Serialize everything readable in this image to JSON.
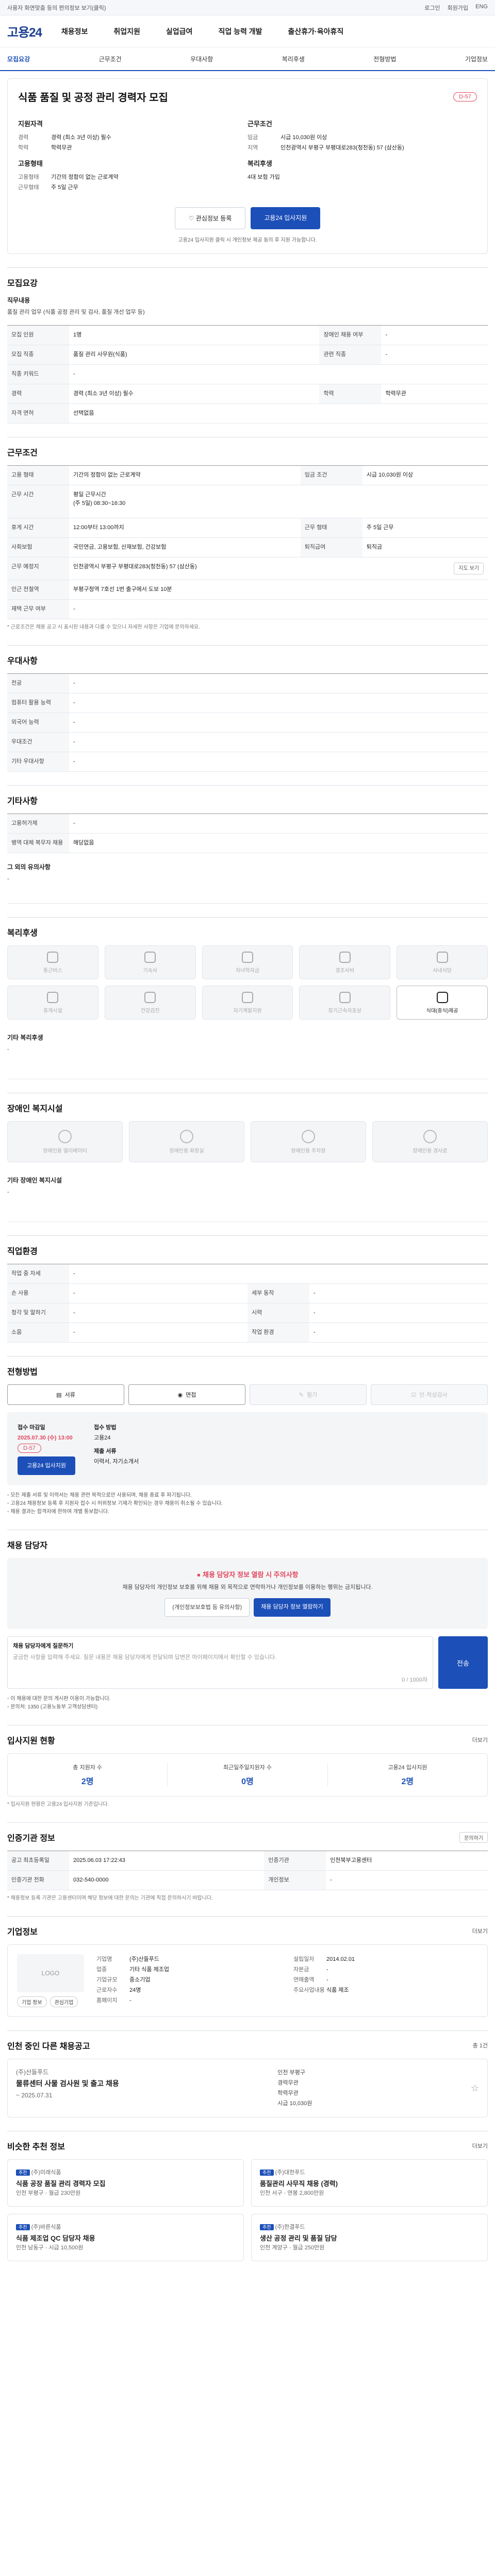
{
  "topbar": {
    "notice": "사용자 화면맞춤 등의 편의정보 보기(클릭)",
    "links": [
      "로그인",
      "회원가입",
      "ENG"
    ]
  },
  "header": {
    "logo": "고용24",
    "menu": [
      "채용정보",
      "취업지원",
      "실업급여",
      "직업 능력 개발",
      "출산휴가·육아휴직"
    ]
  },
  "subnav": {
    "items": [
      "모집요강",
      "근무조건",
      "우대사항",
      "복리후생",
      "전형방법",
      "기업정보"
    ]
  },
  "job": {
    "title": "식품 품질 및 공정 관리 경력자 모집",
    "dday": "D-57",
    "recruit_title": "지원자격",
    "work_title": "근무조건",
    "recruit": [
      [
        "경력",
        "경력 (최소 3년 이상) 필수"
      ],
      [
        "학력",
        "학력무관"
      ]
    ],
    "work": [
      [
        "임금",
        "시급 10,030원 이상"
      ],
      [
        "지역",
        "인천광역시 부평구 부평대로283(청천동) 57 (삼산동)"
      ]
    ],
    "employ_title": "고용형태",
    "welfare_title": "복리후생",
    "employ": [
      [
        "고용형태",
        "기간의 정함이 없는 근로계약"
      ],
      [
        "근무형태",
        "주 5일 근무"
      ]
    ],
    "welfare": "4대 보험 가입",
    "btn_scrap": "관심정보 등록",
    "btn_apply": "고용24 입사지원",
    "note": "고용24 입사지원 클릭 시 개인정보 제공 동의 후 지원 가능합니다."
  },
  "recruit_sec": {
    "title": "모집요강",
    "duty_title": "직무내용",
    "duty": "품질 관리 업무 (식품 공정 관리 및 검사, 품질 개선 업무 등)",
    "rows": [
      [
        "모집 인원",
        "1명",
        "장애인 채용 여부",
        "-"
      ],
      [
        "모집 직종",
        "품질 관리 사무원(식품)",
        "관련 직종",
        "-"
      ],
      [
        "직종 키워드",
        "-",
        "",
        ""
      ],
      [
        "경력",
        "경력 (최소 3년 이상) 필수",
        "학력",
        "학력무관"
      ],
      [
        "자격 면허",
        "선택없음",
        "",
        ""
      ]
    ]
  },
  "work_sec": {
    "title": "근무조건",
    "rows": [
      [
        "고용 형태",
        "기간의 정함이 없는 근로계약",
        "임금 조건",
        "시급 10,030원 이상"
      ],
      [
        "근무 시간",
        "평일 근무시간\n(주 5일) 08:30~16:30",
        "",
        ""
      ],
      [
        "휴게 시간",
        "12:00부터 13:00까지",
        "근무 형태",
        "주 5일 근무"
      ],
      [
        "사회보험",
        "국민연금, 고용보험, 산재보험, 건강보험",
        "퇴직급여",
        "퇴직금"
      ],
      [
        "근무 예정지",
        "인천광역시 부평구 부평대로283(청천동) 57 (삼산동)",
        "",
        ""
      ],
      [
        "인근 전철역",
        "부평구청역 7호선 1번 출구에서 도보 10분",
        "",
        ""
      ],
      [
        "재택 근무 여부",
        "-",
        "",
        ""
      ]
    ],
    "map_btn": "지도 보기",
    "foot": "* 근로조건은 채용 공고 시 표시된 내용과 다를 수 있으니 자세한 사항은 기업에 문의하세요."
  },
  "pref_sec": {
    "title": "우대사항",
    "rows": [
      [
        "전공",
        "-"
      ],
      [
        "컴퓨터 활용 능력",
        "-"
      ],
      [
        "외국어 능력",
        "-"
      ],
      [
        "우대조건",
        "-"
      ],
      [
        "기타 우대사항",
        "-"
      ]
    ]
  },
  "etc_sec": {
    "title": "기타사항",
    "rows": [
      [
        "고용허가제",
        "-"
      ],
      [
        "병역 대체 복무자 채용",
        "해당없음"
      ]
    ],
    "extra_title": "그 외의 유의사항",
    "extra": "-"
  },
  "welfare_sec": {
    "title": "복리후생",
    "items": [
      "통근버스",
      "기숙사",
      "자녀학자금",
      "경조사비",
      "사내식당",
      "휴게시설",
      "건강검진",
      "자기계발지원",
      "장기근속자포상",
      "식대(중식)제공"
    ],
    "on_index": 9,
    "etc_title": "기타 복리후생",
    "etc": "-"
  },
  "disabled_sec": {
    "title": "장애인 복지시설",
    "items": [
      "장애인용 엘리베이터",
      "장애인용 화장실",
      "장애인용 주차장",
      "장애인용 경사로"
    ],
    "etc_title": "기타 장애인 복지시설",
    "etc": "-"
  },
  "org_sec": {
    "title": "직업환경",
    "rows": [
      [
        "작업 중 자세",
        "-",
        "",
        ""
      ],
      [
        "손 사용",
        "-",
        "세부 동작",
        "-"
      ],
      [
        "청각 및 말하기",
        "-",
        "시력",
        "-"
      ],
      [
        "소음",
        "-",
        "작업 환경",
        "-"
      ]
    ]
  },
  "process_sec": {
    "title": "전형방법",
    "tabs": [
      "서류",
      "면접",
      "필기",
      "인·적성검사"
    ],
    "deadline_label": "접수 마감일",
    "deadline": "2025.07.30 (수) 13:00",
    "dday": "D-57",
    "apply_btn": "고용24 입사지원",
    "method_label": "접수 방법",
    "method": "고용24",
    "docs_label": "제출 서류",
    "docs": "이력서, 자기소개서",
    "notes": [
      "◦ 모든 제출 서류 및 이력서는 채용 관련 목적으로만 사용되며, 채용 종료 후 파기됩니다.",
      "◦ 고용24 채용정보 등록 후 지원자 접수 시 허위정보 기재가 확인되는 경우 채용이 취소될 수 있습니다.",
      "◦ 채용 결과는 합격자에 한하여 개별 통보합니다."
    ]
  },
  "manager_sec": {
    "title": "채용 담당자",
    "warn": "채용 담당자 정보 열람 시 주의사항",
    "text": "채용 담당자의 개인정보 보호를 위해 채용 외 목적으로 연락하거나 개인정보를 이용하는 행위는 금지됩니다.",
    "btn1": "채용 담당자 정보 열람하기",
    "btn2": "(개인정보보호법 등 유의사항)",
    "q_title": "채용 담당자에게 질문하기",
    "q_placeholder": "궁금한 사항을 입력해 주세요. 질문 내용은 채용 담당자에게 전달되며 답변은 마이페이지에서 확인할 수 있습니다.",
    "q_count": "0 / 1000자",
    "q_send": "전송",
    "q_notes": [
      "◦ 이 채용에 대한 문의 게시판 이용이 가능합니다.",
      "◦ 문의처: 1350 (고용노동부 고객상담센터)"
    ]
  },
  "status_sec": {
    "title": "입사지원 현황",
    "more": "더보기",
    "stats": [
      [
        "총 지원자 수",
        "2명"
      ],
      [
        "최근일주일지원자 수",
        "0명"
      ],
      [
        "고용24 입사지원",
        "2명"
      ]
    ],
    "foot": "* 입사지원 현황은 고용24 입사지원 기준입니다."
  },
  "info_sec": {
    "title": "인증기관 정보",
    "rows": [
      [
        "공고 최초등록일",
        "2025.06.03 17:22:43",
        "인증기관",
        "인천북부고용센터"
      ],
      [
        "인증기관 전화",
        "032-540-0000",
        "개인정보",
        "-"
      ]
    ],
    "btn": "문의하기",
    "foot": "* 채용정보 등록 기관은 고용센터이며 해당 정보에 대한 문의는 기관에 직접 문의하시기 바랍니다."
  },
  "corp_sec": {
    "title": "기업정보",
    "more": "더보기",
    "logo": "LOGO",
    "chips": [
      "기업 정보",
      "관심기업"
    ],
    "fields": [
      [
        "기업명",
        "(주)산들푸드"
      ],
      [
        "업종",
        "기타 식품 제조업"
      ],
      [
        "기업규모",
        "중소기업"
      ],
      [
        "근로자수",
        "24명"
      ],
      [
        "홈페이지",
        "-"
      ]
    ],
    "fields2": [
      [
        "설립일자",
        "2014.02.01"
      ],
      [
        "자본금",
        "-"
      ],
      [
        "연매출액",
        "-"
      ],
      [
        "주요사업내용",
        "식품 제조"
      ]
    ]
  },
  "other_sec": {
    "title": "인천 중인 다른 채용공고",
    "meta": "총 1건",
    "company": "(주)산들푸드",
    "job_title": "물류센터 사물 검사원 및 출고 채용",
    "date": "~ 2025.07.31",
    "info": [
      "인천 부평구",
      "경력무관",
      "학력무관",
      "시급 10,030원"
    ]
  },
  "similar_sec": {
    "title": "비슷한 추천 정보",
    "more": "더보기",
    "cards": [
      {
        "tag": "추천",
        "company": "(주)미래식품",
        "title": "식품 공장 품질 관리 경력자 모집",
        "loc": "인천 부평구",
        "pay": "월급 230만원"
      },
      {
        "tag": "추천",
        "company": "(주)대한푸드",
        "title": "품질관리 사무직 채용 (경력)",
        "loc": "인천 서구",
        "pay": "연봉 2,800만원"
      },
      {
        "tag": "추천",
        "company": "(주)바른식품",
        "title": "식품 제조업 QC 담당자 채용",
        "loc": "인천 남동구",
        "pay": "시급 10,500원"
      },
      {
        "tag": "추천",
        "company": "(주)한결푸드",
        "title": "생산 공정 관리 및 품질 담당",
        "loc": "인천 계양구",
        "pay": "월급 250만원"
      }
    ]
  }
}
